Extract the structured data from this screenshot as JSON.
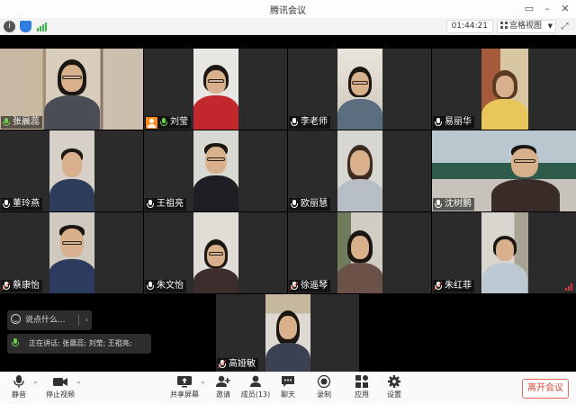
{
  "window": {
    "title": "腾讯会议"
  },
  "status_bar": {
    "timer": "01:44:21",
    "view_mode": "宫格视图"
  },
  "participants": [
    {
      "name": "张晨蕊",
      "mic": "active",
      "speaking": true
    },
    {
      "name": "刘莹",
      "mic": "active",
      "host": true
    },
    {
      "name": "李老师",
      "mic": "on"
    },
    {
      "name": "易丽华",
      "mic": "on"
    },
    {
      "name": "董玲燕",
      "mic": "on"
    },
    {
      "name": "王祖亮",
      "mic": "on"
    },
    {
      "name": "欧丽慧",
      "mic": "on"
    },
    {
      "name": "沈树鹏",
      "mic": "on"
    },
    {
      "name": "蔡康怡",
      "mic": "muted"
    },
    {
      "name": "朱文怡",
      "mic": "on"
    },
    {
      "name": "徐遥琴",
      "mic": "muted"
    },
    {
      "name": "朱红菲",
      "mic": "muted",
      "weak_signal": true
    },
    {
      "name": "高娅敏",
      "mic": "muted"
    }
  ],
  "chat": {
    "placeholder": "说点什么..."
  },
  "speaking_indicator": {
    "text": "正在讲话: 张晨蕊; 刘莹; 王祖亮;"
  },
  "toolbar": {
    "mute": "静音",
    "stop_video": "停止视频",
    "share_screen": "共享屏幕",
    "invite": "邀请",
    "members": "成员(13)",
    "chat": "聊天",
    "record": "录制",
    "apps": "应用",
    "settings": "设置",
    "leave": "离开会议"
  },
  "colors": {
    "speaking_border": "#7cd34b",
    "active_mic": "#68d049",
    "host_badge": "#ff8a1e",
    "leave_text": "#d9483b"
  }
}
